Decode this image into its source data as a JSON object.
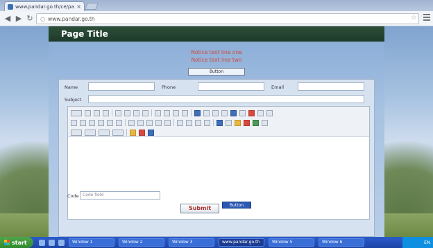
{
  "browser": {
    "tab_title": "www.pandar.go.th/ce/page",
    "tab_close": "×",
    "url": "www.pandar.go.th",
    "star": "☆"
  },
  "page": {
    "title": "Page Title",
    "notice_line1": "Notice text line one",
    "notice_line2": "Notice text line two",
    "notice_button": "Button",
    "form": {
      "label_name": "Name",
      "label_phone": "Phone",
      "label_email": "Email",
      "label_subject": "Subject",
      "captcha_label": "Code",
      "captcha_value": "Code field"
    },
    "submit_label": "Submit",
    "secondary_label": "Button"
  },
  "taskbar": {
    "start_label": "start",
    "tasks": [
      "Window 1",
      "Window 2",
      "Window 3",
      "www.pandar.go.th",
      "Window 5",
      "Window 6"
    ],
    "tray_text": "EN"
  },
  "colors": {
    "title_bar": "#1e3a2a",
    "notice_red": "#d04a3a",
    "taskbar_blue": "#1d45a8",
    "start_green": "#2f8a2e"
  },
  "icons": [
    "back-arrow-icon",
    "reload-icon",
    "lock-icon",
    "star-icon",
    "chrome-menu-icon",
    "windows-logo-icon"
  ]
}
